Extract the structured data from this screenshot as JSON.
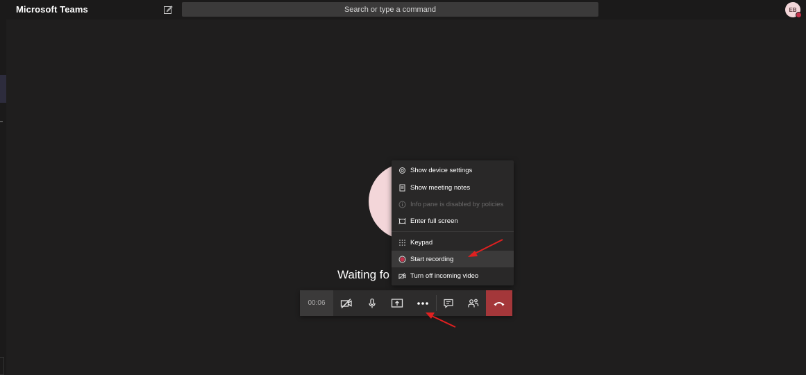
{
  "app": {
    "title": "Microsoft Teams"
  },
  "search": {
    "placeholder": "Search or type a command"
  },
  "user": {
    "initials": "EB"
  },
  "call": {
    "status_text": "Waiting fo",
    "timer": "00:06"
  },
  "more_menu": {
    "items": [
      {
        "label": "Show device settings",
        "icon": "gear-icon",
        "enabled": true
      },
      {
        "label": "Show meeting notes",
        "icon": "notes-icon",
        "enabled": true
      },
      {
        "label": "Info pane is disabled by policies",
        "icon": "info-icon",
        "enabled": false
      },
      {
        "label": "Enter full screen",
        "icon": "fullscreen-icon",
        "enabled": true
      },
      {
        "label": "Keypad",
        "icon": "keypad-icon",
        "enabled": true
      },
      {
        "label": "Start recording",
        "icon": "record-icon",
        "enabled": true,
        "highlighted": true
      },
      {
        "label": "Turn off incoming video",
        "icon": "video-off-icon",
        "enabled": true
      }
    ]
  },
  "colors": {
    "background": "#1f1e1e",
    "hangup": "#a4373a",
    "avatar": "#f3d6d9",
    "annotation_arrow": "#e02020",
    "record_dot": "#c4314b"
  }
}
